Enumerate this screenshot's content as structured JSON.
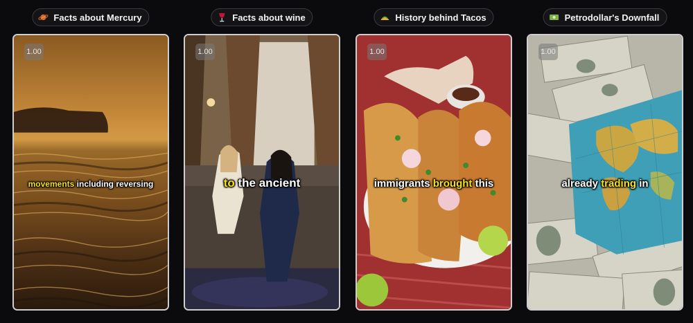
{
  "cards": [
    {
      "title": "Facts about Mercury",
      "icon": "ringed-planet-icon",
      "speed": "1.00",
      "caption_parts": [
        {
          "text": "movements",
          "highlight": true
        },
        {
          "text": " including reversing",
          "highlight": false
        }
      ]
    },
    {
      "title": "Facts about wine",
      "icon": "wine-glass-icon",
      "speed": "1.00",
      "caption_parts": [
        {
          "text": "to",
          "highlight": true
        },
        {
          "text": " the ancient",
          "highlight": false
        }
      ]
    },
    {
      "title": "History behind Tacos",
      "icon": "taco-icon",
      "speed": "1.00",
      "caption_parts": [
        {
          "text": "immigrants ",
          "highlight": false
        },
        {
          "text": "brought",
          "highlight": true
        },
        {
          "text": " this",
          "highlight": false
        }
      ]
    },
    {
      "title": "Petrodollar's Downfall",
      "icon": "dollar-bill-icon",
      "speed": "1.00",
      "caption_parts": [
        {
          "text": "already ",
          "highlight": false
        },
        {
          "text": "trading",
          "highlight": true
        },
        {
          "text": " in",
          "highlight": false
        }
      ]
    }
  ],
  "colors": {
    "background": "#0b0b0d",
    "highlight": "#f5e11c"
  }
}
